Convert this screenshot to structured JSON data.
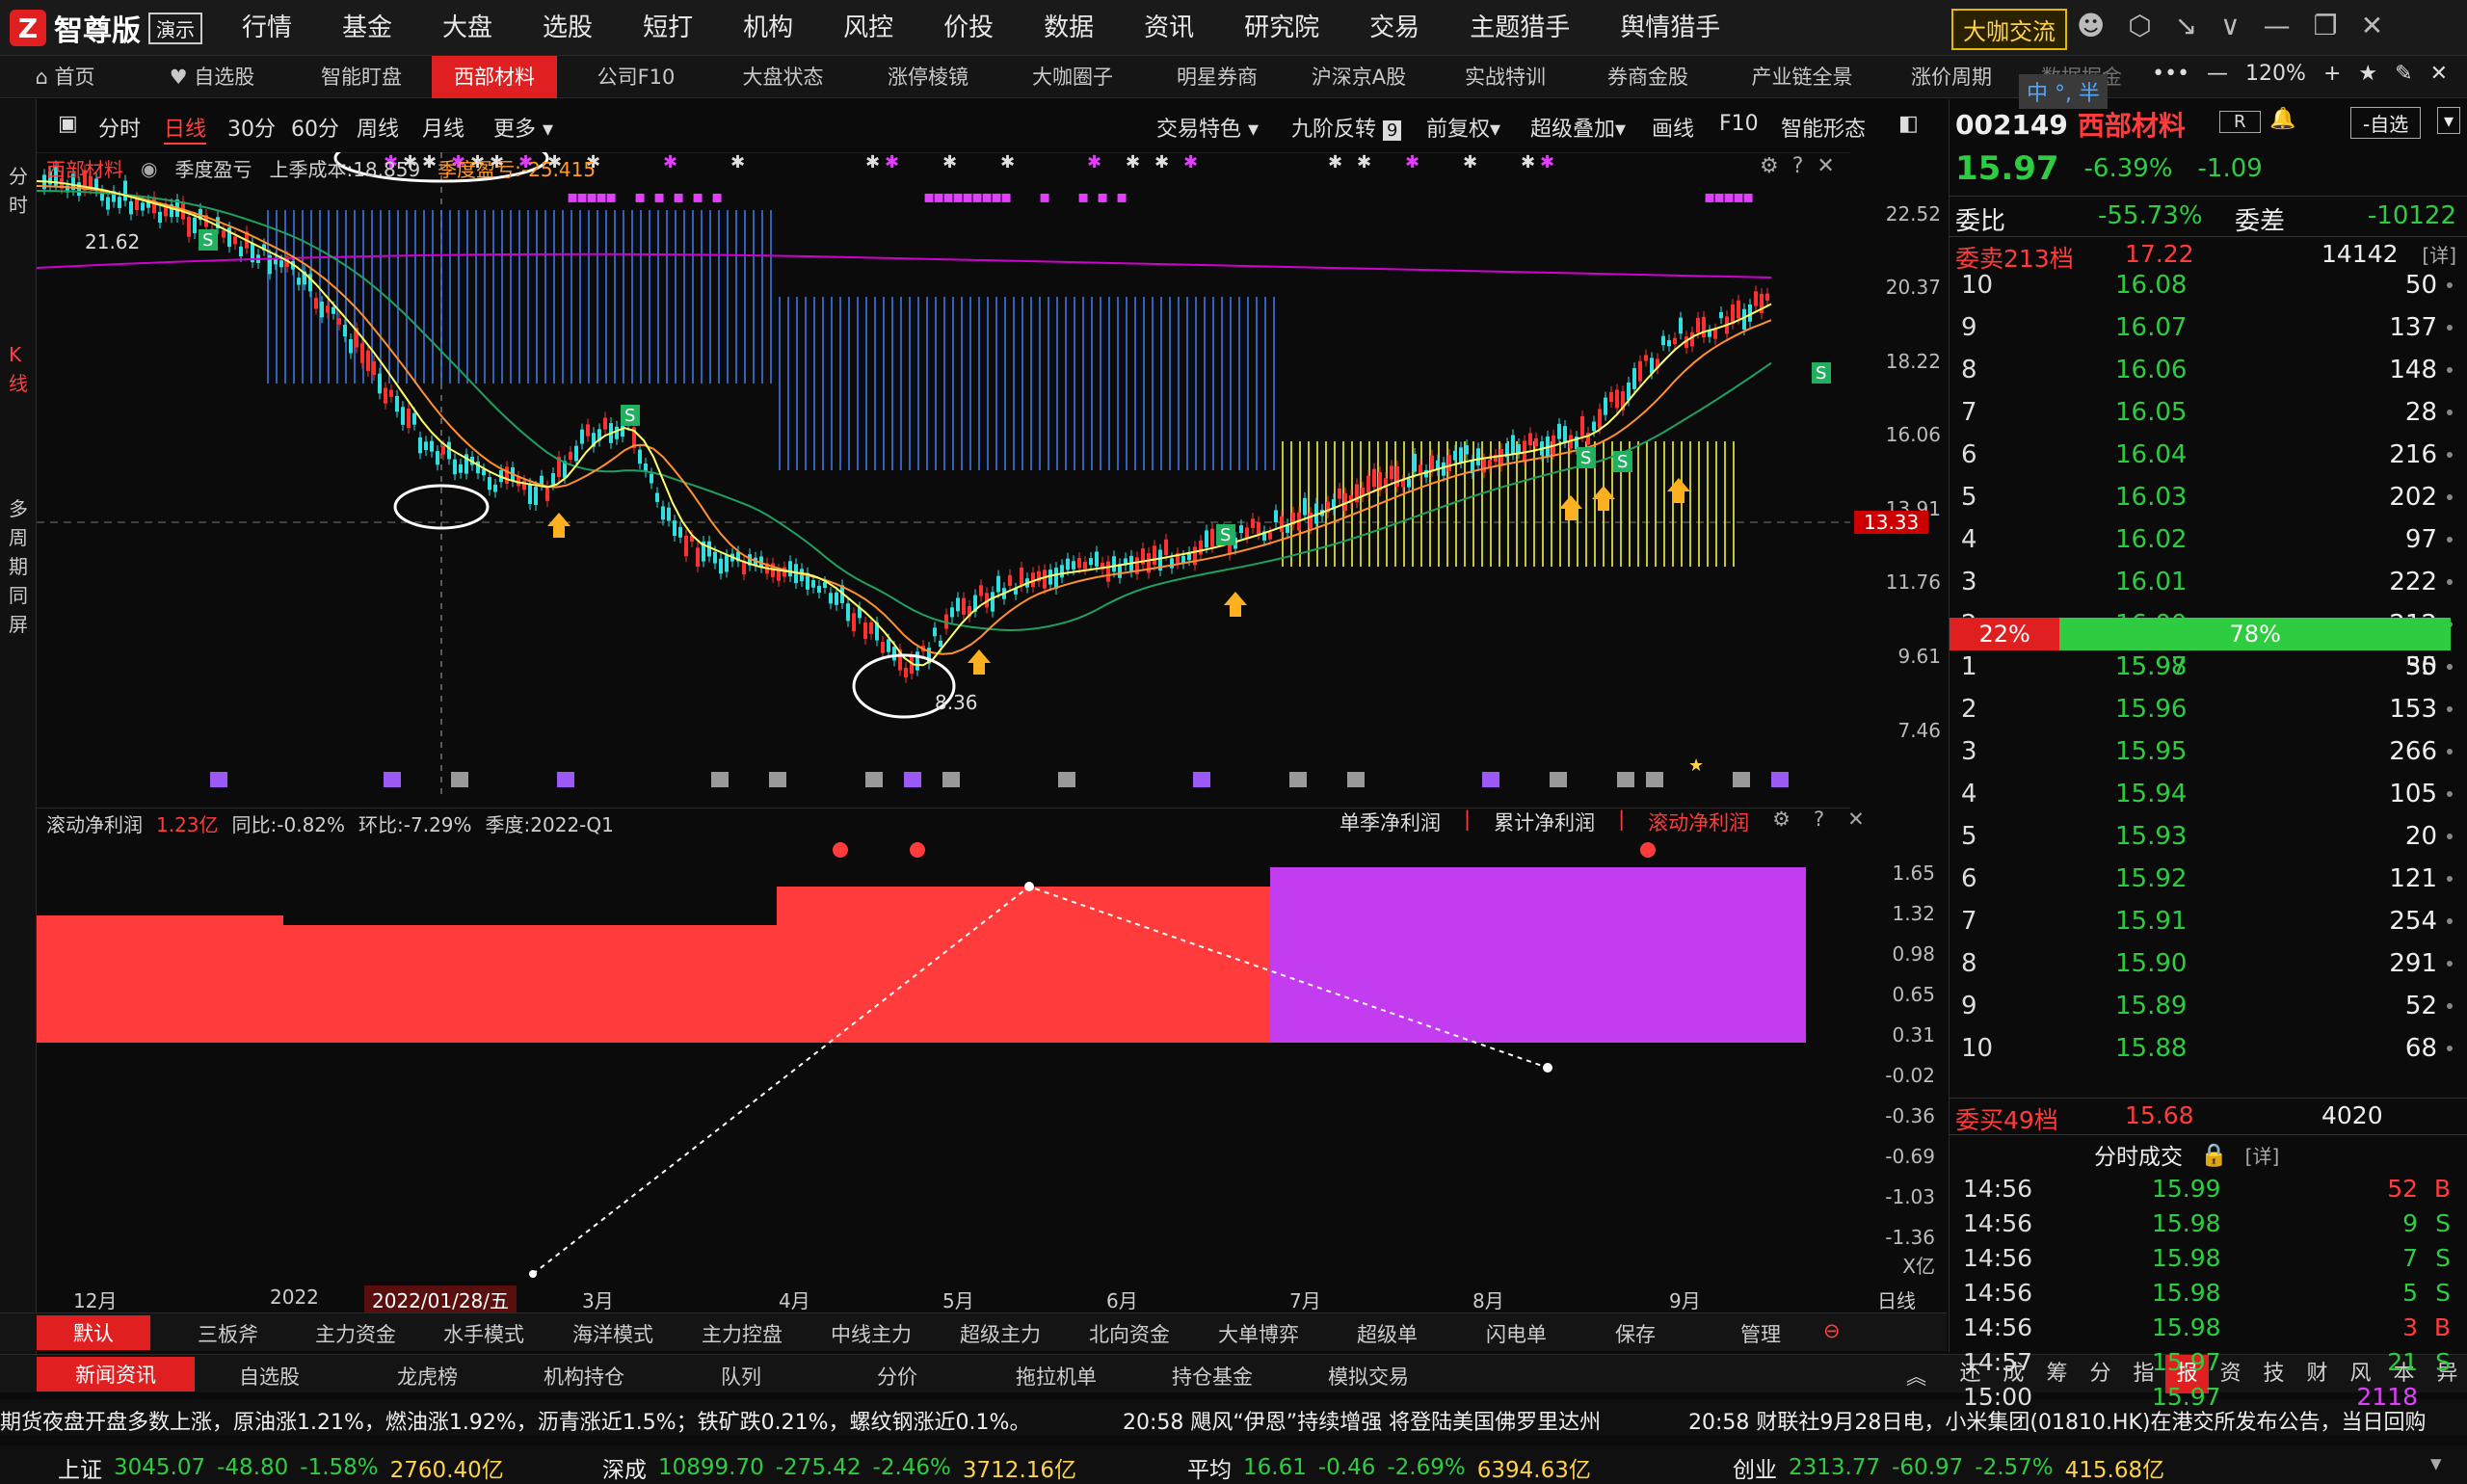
{
  "app": {
    "logo_mark": "Z",
    "name": "智尊版",
    "demo_badge": "演示",
    "menu": [
      "行情",
      "基金",
      "大盘",
      "选股",
      "短打",
      "机构",
      "风控",
      "价投",
      "数据",
      "资讯",
      "研究院",
      "交易",
      "主题猎手",
      "舆情猎手"
    ],
    "highlight_button": "大咖交流"
  },
  "tabs": {
    "items": [
      "首页",
      "自选股",
      "智能盯盘",
      "西部材料",
      "公司F10",
      "大盘状态",
      "涨停棱镜",
      "大咖圈子",
      "明星券商",
      "沪深京A股",
      "实战特训",
      "券商金股",
      "产业链全景",
      "涨价周期",
      "数据掘金"
    ],
    "active_index": 3,
    "more": "•••",
    "zoom": "120%"
  },
  "left_strip": {
    "fenshi": "分时",
    "kline": "K线",
    "multi": "多周期同屏"
  },
  "chart_toolbar": {
    "periods": [
      "分时",
      "日线",
      "30分",
      "60分",
      "周线",
      "月线",
      "更多"
    ],
    "active_period": "日线",
    "tools": [
      "交易特色",
      "九阶反转",
      "前复权",
      "超级叠加",
      "画线",
      "F10",
      "智能形态"
    ],
    "nine_badge": "9"
  },
  "kline_info": {
    "name": "西部材料",
    "indicator": "季度盈亏",
    "cost": "上季成本:18.859",
    "pnl": "季度盈亏:-25.415"
  },
  "kline_axis": {
    "ticks": [
      "22.52",
      "20.37",
      "18.22",
      "16.06",
      "13.91",
      "11.76",
      "9.61",
      "7.46"
    ],
    "current_label": "13.33",
    "high_label": "21.62",
    "low_label": "8.36"
  },
  "indicator": {
    "name": "滚动净利润",
    "value": "1.23亿",
    "yoy": "同比:-0.82%",
    "qoq": "环比:-7.29%",
    "season": "季度:2022-Q1",
    "tabs": [
      "单季净利润",
      "累计净利润",
      "滚动净利润"
    ],
    "active_tab": "滚动净利润",
    "axis_ticks": [
      "1.65",
      "1.32",
      "0.98",
      "0.65",
      "0.31",
      "-0.02",
      "-0.36",
      "-0.69",
      "-1.03",
      "-1.36"
    ],
    "unit": "X亿"
  },
  "xaxis": {
    "labels": [
      "12月",
      "2022",
      "2022/01/28/五",
      "3月",
      "4月",
      "5月",
      "6月",
      "7月",
      "8月",
      "9月"
    ],
    "period": "日线"
  },
  "bottom_tabs1": [
    "默认",
    "三板斧",
    "主力资金",
    "水手模式",
    "海洋模式",
    "主力控盘",
    "中线主力",
    "超级主力",
    "北向资金",
    "大单博弈",
    "超级单",
    "闪电单",
    "保存",
    "管理"
  ],
  "bottom_tabs2": [
    "新闻资讯",
    "自选股",
    "龙虎榜",
    "机构持仓",
    "队列",
    "分价",
    "拖拉机单",
    "持仓基金",
    "模拟交易"
  ],
  "bottom_right_tools": [
    "还",
    "成",
    "筹",
    "分",
    "指",
    "报",
    "资",
    "技",
    "财",
    "风",
    "本",
    "异"
  ],
  "bottom_right_active": "报",
  "news": [
    "期货夜盘开盘多数上涨，原油涨1.21%，燃油涨1.92%，沥青涨近1.5%；铁矿跌0.21%，螺纹钢涨近0.1%。",
    "20:58 飓风“伊恩”持续增强 将登陆美国佛罗里达州",
    "20:58 财联社9月28日电，小米集团(01810.HK)在港交所发布公告，当日回购"
  ],
  "indices": [
    {
      "name": "上证",
      "value": "3045.07",
      "change": "-48.80",
      "pct": "-1.58%",
      "amount": "2760.40亿"
    },
    {
      "name": "深成",
      "value": "10899.70",
      "change": "-275.42",
      "pct": "-2.46%",
      "amount": "3712.16亿"
    },
    {
      "name": "平均",
      "value": "16.61",
      "change": "-0.46",
      "pct": "-2.69%",
      "amount": "6394.63亿"
    },
    {
      "name": "创业",
      "value": "2313.77",
      "change": "-60.97",
      "pct": "-2.57%",
      "amount": "415.68亿"
    }
  ],
  "quote": {
    "code": "002149",
    "name": "西部材料",
    "r_badge": "R",
    "watch_button": "-自选",
    "price": "15.97",
    "pct": "-6.39%",
    "change": "-1.09",
    "ratio_label": "委比",
    "ratio": "-55.73%",
    "diff_label": "委差",
    "diff": "-10122",
    "sell_total_label": "委卖213档",
    "sell_total_price": "17.22",
    "sell_total_vol": "14142",
    "detail": "[详]",
    "sells": [
      {
        "lvl": "10",
        "price": "16.08",
        "vol": "50"
      },
      {
        "lvl": "9",
        "price": "16.07",
        "vol": "137"
      },
      {
        "lvl": "8",
        "price": "16.06",
        "vol": "148"
      },
      {
        "lvl": "7",
        "price": "16.05",
        "vol": "28"
      },
      {
        "lvl": "6",
        "price": "16.04",
        "vol": "216"
      },
      {
        "lvl": "5",
        "price": "16.03",
        "vol": "202"
      },
      {
        "lvl": "4",
        "price": "16.02",
        "vol": "97"
      },
      {
        "lvl": "3",
        "price": "16.01",
        "vol": "222"
      },
      {
        "lvl": "2",
        "price": "16.00",
        "vol": "212"
      },
      {
        "lvl": "1",
        "price": "15.98",
        "vol": "30"
      }
    ],
    "bar_left": "22%",
    "bar_right": "78%",
    "bar_left_fraction": 0.22,
    "buys": [
      {
        "lvl": "1",
        "price": "15.97",
        "vol": "55"
      },
      {
        "lvl": "2",
        "price": "15.96",
        "vol": "153"
      },
      {
        "lvl": "3",
        "price": "15.95",
        "vol": "266"
      },
      {
        "lvl": "4",
        "price": "15.94",
        "vol": "105"
      },
      {
        "lvl": "5",
        "price": "15.93",
        "vol": "20"
      },
      {
        "lvl": "6",
        "price": "15.92",
        "vol": "121"
      },
      {
        "lvl": "7",
        "price": "15.91",
        "vol": "254"
      },
      {
        "lvl": "8",
        "price": "15.90",
        "vol": "291"
      },
      {
        "lvl": "9",
        "price": "15.89",
        "vol": "52"
      },
      {
        "lvl": "10",
        "price": "15.88",
        "vol": "68"
      }
    ],
    "buy_total_label": "委买49档",
    "buy_total_price": "15.68",
    "buy_total_vol": "4020",
    "ticks_title": "分时成交",
    "ticks": [
      {
        "time": "14:56",
        "price": "15.99",
        "vol": "52",
        "side": "B"
      },
      {
        "time": "14:56",
        "price": "15.98",
        "vol": "9",
        "side": "S"
      },
      {
        "time": "14:56",
        "price": "15.98",
        "vol": "7",
        "side": "S"
      },
      {
        "time": "14:56",
        "price": "15.98",
        "vol": "5",
        "side": "S"
      },
      {
        "time": "14:56",
        "price": "15.98",
        "vol": "3",
        "side": "B"
      },
      {
        "time": "14:57",
        "price": "15.97",
        "vol": "21",
        "side": "S"
      },
      {
        "time": "15:00",
        "price": "15.97",
        "vol": "2118",
        "side": ""
      }
    ],
    "ime": "中 °, 半"
  },
  "colors": {
    "up": "#ff3b3b",
    "down": "#2ecc40",
    "accent": "#e02020",
    "highlight": "#ffd24d",
    "magenta": "#e040fb"
  }
}
